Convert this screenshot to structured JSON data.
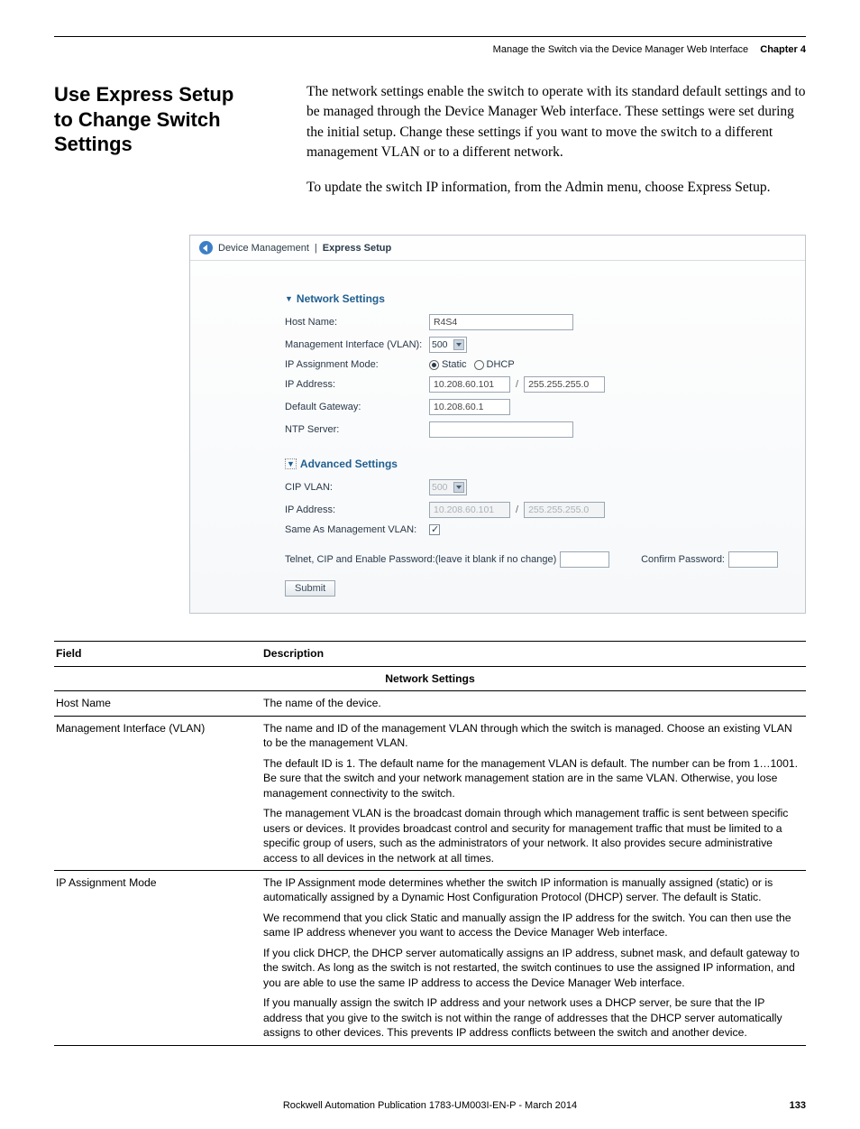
{
  "header": {
    "title": "Manage the Switch via the Device Manager Web Interface",
    "chapter": "Chapter 4"
  },
  "section_title_l1": "Use Express Setup",
  "section_title_l2": "to Change Switch Settings",
  "para1": "The network settings enable the switch to operate with its standard default settings and to be managed through the Device Manager Web interface. These settings were set during the initial setup. Change these settings if you want to move the switch to a different management VLAN or to a different network.",
  "para2": "To update the switch IP information, from the Admin menu, choose Express Setup.",
  "panel": {
    "breadcrumb1": "Device Management",
    "breadcrumb2": "Express Setup",
    "net_head": "Network Settings",
    "host_lbl": "Host Name:",
    "host_val": "R4S4",
    "mgmt_lbl": "Management Interface (VLAN):",
    "vlan_val": "500",
    "ipmode_lbl": "IP Assignment Mode:",
    "static_lbl": "Static",
    "dhcp_lbl": "DHCP",
    "ip_lbl": "IP Address:",
    "ip_val": "10.208.60.101",
    "mask_val": "255.255.255.0",
    "gw_lbl": "Default Gateway:",
    "gw_val": "10.208.60.1",
    "ntp_lbl": "NTP Server:",
    "adv_head": "Advanced Settings",
    "cip_lbl": "CIP VLAN:",
    "cip_vlan": "500",
    "ip2_lbl": "IP Address:",
    "ip2_val": "10.208.60.101",
    "mask2_val": "255.255.255.0",
    "same_lbl": "Same As Management VLAN:",
    "pw_lbl": "Telnet, CIP and Enable Password:(leave it blank if no change)",
    "confirm_lbl": "Confirm Password:",
    "submit": "Submit"
  },
  "table": {
    "h1": "Field",
    "h2": "Description",
    "section": "Network Settings",
    "r1f": "Host Name",
    "r1d": "The name of the device.",
    "r2f": "Management Interface (VLAN)",
    "r2d1": "The name and ID of the management VLAN through which the switch is managed. Choose an existing VLAN to be the management VLAN.",
    "r2d2": "The default ID is 1. The default name for the management VLAN is default. The number can be from 1…1001. Be sure that the switch and your network management station are in the same VLAN. Otherwise, you lose management connectivity to the switch.",
    "r2d3": "The management VLAN is the broadcast domain through which management traffic is sent between specific users or devices. It provides broadcast control and security for management traffic that must be limited to a specific group of users, such as the administrators of your network. It also provides secure administrative access to all devices in the network at all times.",
    "r3f": "IP Assignment Mode",
    "r3d1": "The IP Assignment mode determines whether the switch IP information is manually assigned (static) or is automatically assigned by a Dynamic Host Configuration Protocol (DHCP) server. The default is Static.",
    "r3d2": "We recommend that you click Static and manually assign the IP address for the switch. You can then use the same IP address whenever you want to access the Device Manager Web interface.",
    "r3d3": "If you click DHCP, the DHCP server automatically assigns an IP address, subnet mask, and default gateway to the switch. As long as the switch is not restarted, the switch continues to use the assigned IP information, and you are able to use the same IP address to access the Device Manager Web interface.",
    "r3d4": "If you manually assign the switch IP address and your network uses a DHCP server, be sure that the IP address that you give to the switch is not within the range of addresses that the DHCP server automatically assigns to other devices. This prevents IP address conflicts between the switch and another device."
  },
  "footer": {
    "pub": "Rockwell Automation Publication 1783-UM003I-EN-P - March 2014",
    "page": "133"
  }
}
